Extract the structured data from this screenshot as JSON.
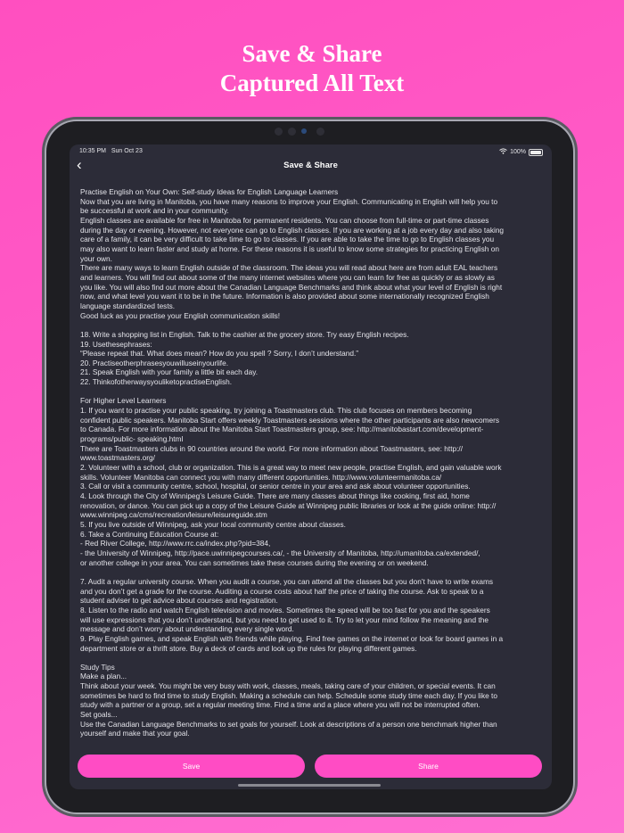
{
  "headline": {
    "line1": "Save & Share",
    "line2": "Captured All Text"
  },
  "status_bar": {
    "time": "10:35 PM",
    "date": "Sun Oct 23",
    "battery": "100%"
  },
  "nav": {
    "back_icon": "chevron-left-icon",
    "title": "Save & Share"
  },
  "content_lines": [
    "Practise English on Your Own: Self-study Ideas for English Language Learners",
    "Now that you are living in Manitoba, you have many reasons to improve your English. Communicating in English will help you to",
    "be successful at work and in your community.",
    "English classes are available for free in Manitoba for permanent residents. You can choose from full-time or part-time classes",
    "during the day or evening. However, not everyone can go to English classes. If you are working at a job every day and also taking",
    "care of a family, it can be very difficult to take time to go to classes. If you are able to take the time to go to English classes you",
    "may also want to learn faster and study at home. For these reasons it is useful to know some strategies for practicing English on",
    "your own.",
    "There are many ways to learn English outside of the classroom. The ideas you will read about here are from adult EAL teachers",
    "and learners. You will find out about some of the many internet websites where you can learn for free as quickly or as slowly as",
    "you like. You will also find out more about the Canadian Language Benchmarks and think about what your level of English is right",
    "now, and what level you want it to be in the future. Information is also provided about some internationally recognized English",
    "language standardized tests.",
    "Good luck as you practise your English communication skills!",
    "",
    "18. Write a shopping list in English. Talk to the cashier at the grocery store. Try easy English recipes.",
    "19. Usethesephrases:",
    "“Please repeat that. What does   mean? How do you spell   ? Sorry, I don’t understand.”",
    "20. Practiseotherphrasesyouwilluseinyourlife.",
    "21. Speak English with your family a little bit each day.",
    "22. ThinkofotherwaysyouliketopractiseEnglish.",
    "",
    "For Higher Level Learners",
    "1. If you want to practise your public speaking, try joining a Toastmasters club. This club focuses on members becoming",
    "confident public speakers. Manitoba Start offers weekly Toastmasters sessions where the other participants are also newcomers",
    "to Canada. For more information about the Manitoba Start Toastmasters group, see: http://manitobastart.com/development-",
    "programs/public- speaking.html",
    "There are Toastmasters clubs in 90 countries around the world. For more information about Toastmasters, see: http://",
    "www.toastmasters.org/",
    "2. Volunteer with a school, club or organization. This is a great way to meet new people, practise English, and gain valuable work",
    "skills. Volunteer Manitoba can connect you with many different opportunities. http://www.volunteermanitoba.ca/",
    "3. Call or visit a community centre, school, hospital, or senior centre in your area and ask about volunteer opportunities.",
    "4. Look through the City of Winnipeg’s Leisure Guide. There are many classes about things like cooking, first aid, home",
    "renovation, or dance. You can pick up a copy of the Leisure Guide at Winnipeg public libraries or look at the guide online: http://",
    "www.winnipeg.ca/cms/recreation/leisure/leisureguide.stm",
    "5. If you live outside of Winnipeg, ask your local community centre about classes.",
    "6. Take a Continuing Education Course at:",
    "- Red River College, http://www.rrc.ca/index.php?pid=384,",
    "- the University of Winnipeg, http://pace.uwinnipegcourses.ca/, - the University of Manitoba, http://umanitoba.ca/extended/,",
    "or another college in your area. You can sometimes take these courses during the evening or on weekend.",
    "",
    "7. Audit a regular university course. When you audit a course, you can attend all the classes but you don’t have to write exams",
    "and you don’t get a grade for the course. Auditing a course costs about half the price of taking the course. Ask to speak to a",
    "student adviser to get advice about courses and registration.",
    "8. Listen to the radio and watch English television and movies. Sometimes the speed will be too fast for you and the speakers",
    "will use expressions that you don’t understand, but you need to get used to it. Try to let your mind follow the meaning and the",
    "message and don’t worry about understanding every single word.",
    "9. Play English games, and speak English with friends while playing. Find free games on the internet or look for board games in a",
    "department store or a thrift store. Buy a deck of cards and look up the rules for playing different games.",
    "",
    "Study Tips",
    "Make a plan...",
    "Think about your week. You might be very busy with work, classes, meals, taking care of your children, or special events. It can",
    "sometimes be hard to find time to study English. Making a schedule can help. Schedule some study time each day. If you like to",
    "study with a partner or a group, set a regular meeting time. Find a time and a place where you will not be interrupted often.",
    "Set goals...",
    "Use the Canadian Language Benchmarks to set goals for yourself. Look at descriptions of a person one benchmark higher than",
    "yourself and make that your goal."
  ],
  "actions": {
    "save_label": "Save",
    "share_label": "Share"
  },
  "colors": {
    "background": "#ff5ac6",
    "accent_button": "#ff4cc4",
    "screen_bg": "#2c2c38"
  }
}
